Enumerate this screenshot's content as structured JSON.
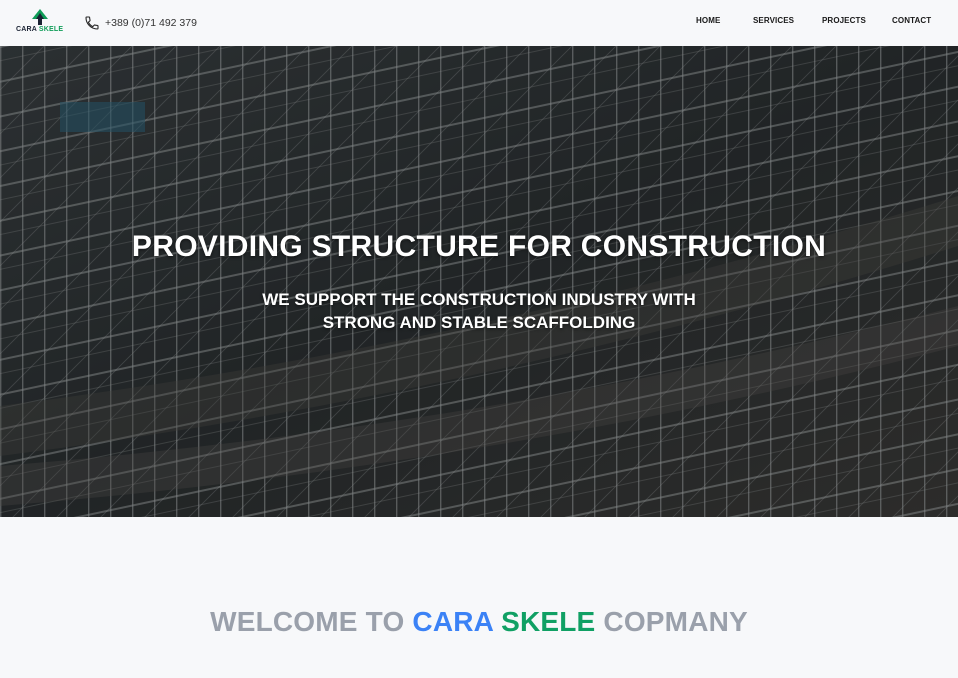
{
  "brand": {
    "logo_part1": "CARA",
    "logo_part2": "SKELE",
    "colors": {
      "accent_blue": "#3b82f6",
      "accent_green": "#10a064",
      "muted": "#9aa0ab"
    }
  },
  "header": {
    "phone_icon": "phone-icon",
    "phone": "+389 (0)71 492 379",
    "nav": [
      {
        "label": "HOME"
      },
      {
        "label": "SERVICES"
      },
      {
        "label": "PROJECTS"
      },
      {
        "label": "CONTACT"
      }
    ]
  },
  "hero": {
    "title": "PROVIDING STRUCTURE FOR CONSTRUCTION",
    "subtitle_line1": "WE SUPPORT THE CONSTRUCTION INDUSTRY WITH",
    "subtitle_line2": "STRONG AND STABLE SCAFFOLDING"
  },
  "welcome": {
    "prefix": "WELCOME TO",
    "name_part1": "CARA",
    "name_part2": "SKELE",
    "suffix": "COPMANY"
  }
}
